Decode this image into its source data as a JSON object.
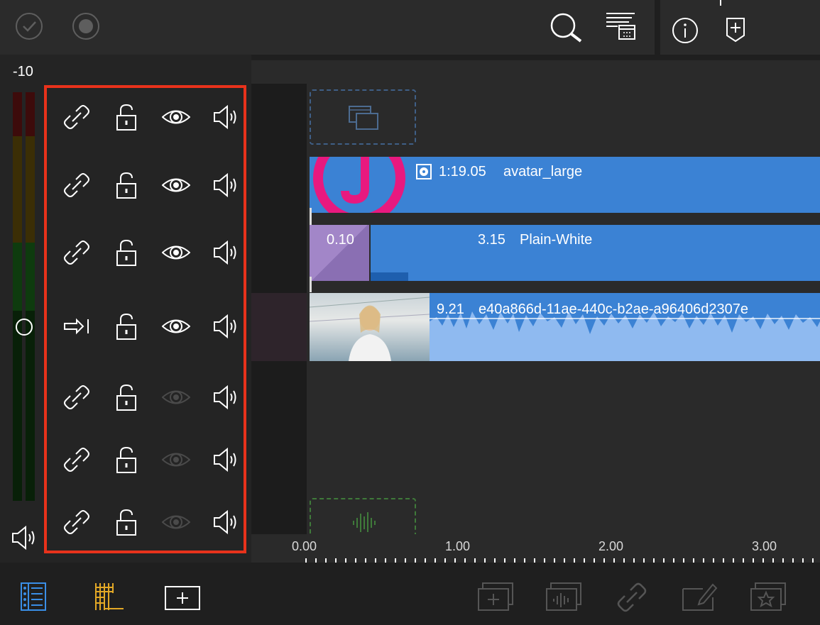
{
  "meter": {
    "db_label": "-10"
  },
  "tracks": [
    {
      "mode": "link",
      "visible": true
    },
    {
      "mode": "link",
      "visible": true
    },
    {
      "mode": "link",
      "visible": true
    },
    {
      "mode": "arrow",
      "visible": true
    },
    {
      "mode": "link",
      "visible": false
    },
    {
      "mode": "link",
      "visible": false
    },
    {
      "mode": "link",
      "visible": false
    }
  ],
  "clips": {
    "avatar": {
      "duration": "1:19.05",
      "name": "avatar_large"
    },
    "transition": {
      "duration": "0.10"
    },
    "plain_white": {
      "duration": "3.15",
      "name": "Plain-White"
    },
    "video": {
      "duration": "9.21",
      "name": "e40a866d-11ae-440c-b2ae-a96406d2307e"
    }
  },
  "ruler": {
    "ticks": [
      "0.00",
      "1.00",
      "2.00",
      "3.00"
    ]
  },
  "colors": {
    "accent_red": "#e8321b",
    "clip_blue": "#3b82d4",
    "wave_blue": "#8fbaf0",
    "toolbar_yellow": "#e3a826",
    "toolbar_blue": "#3a8ee6"
  }
}
